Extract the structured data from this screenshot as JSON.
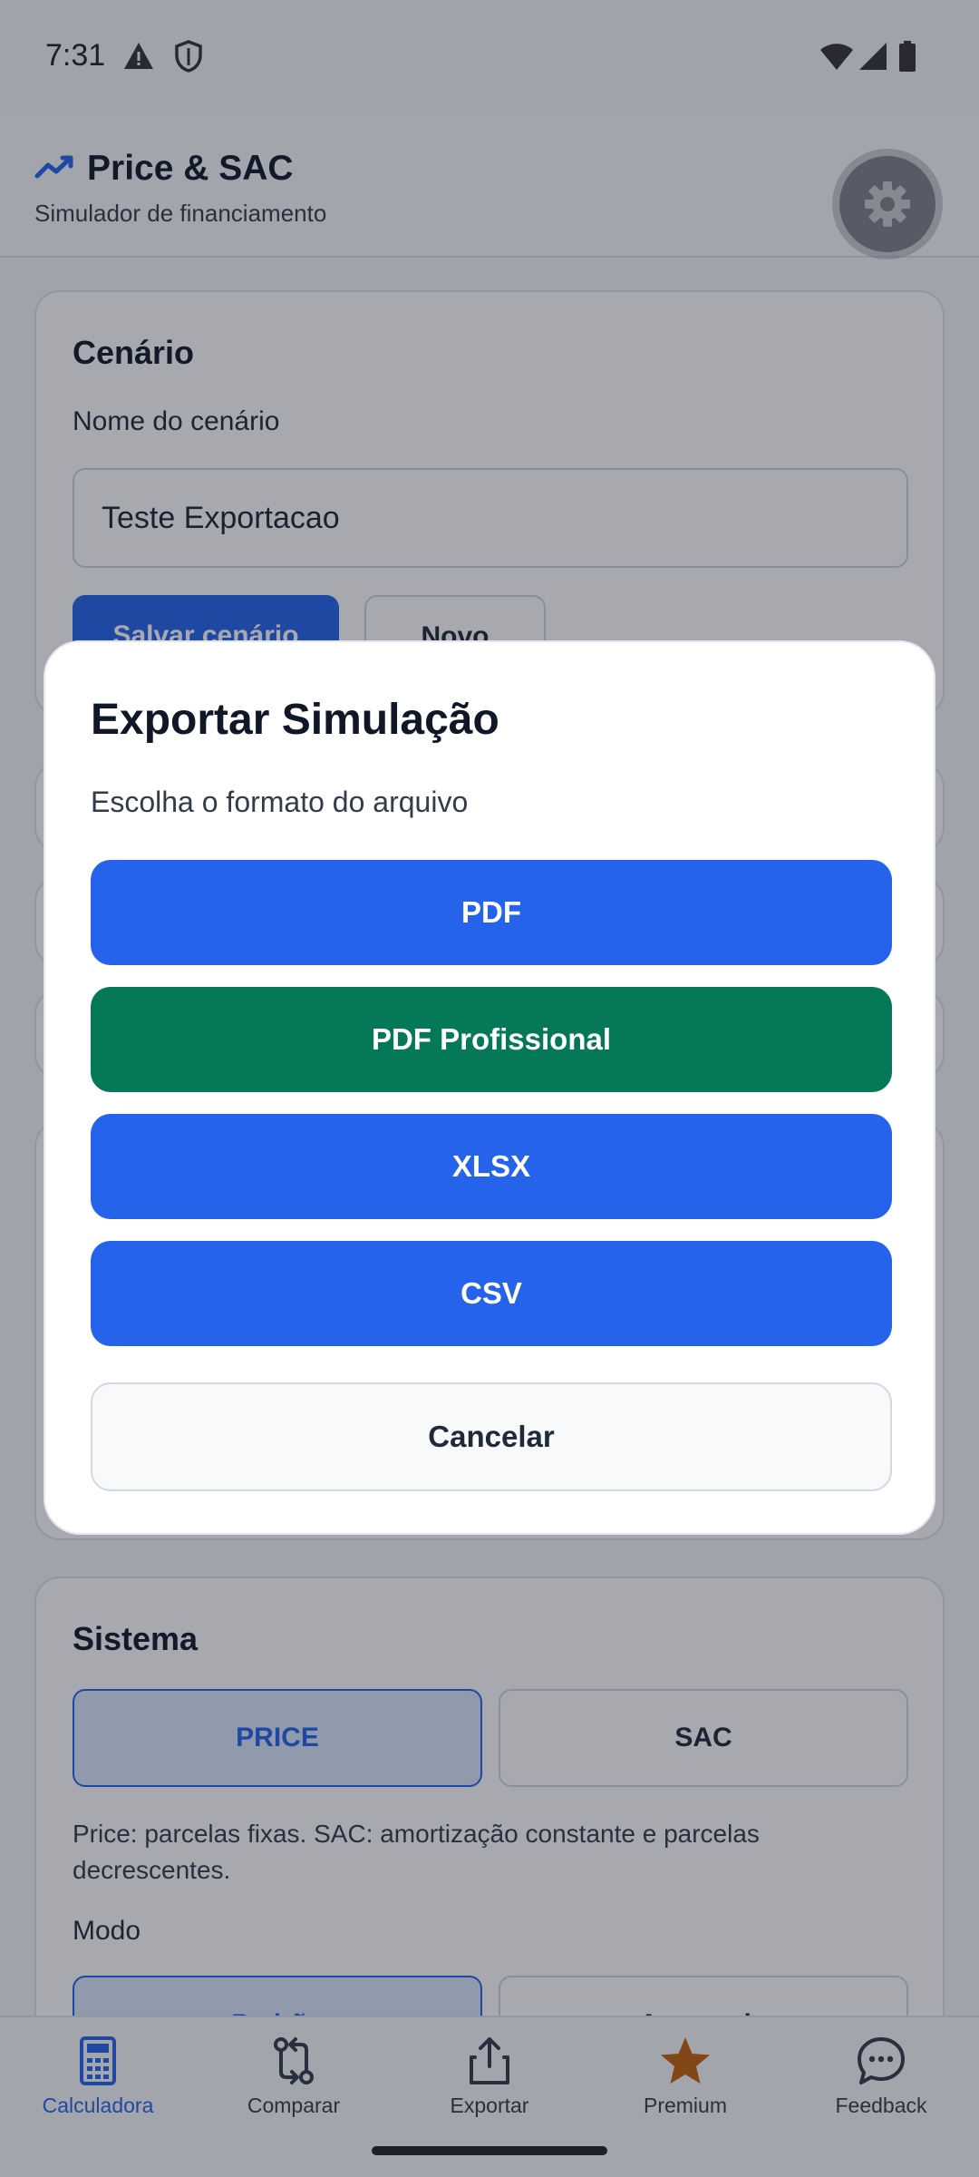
{
  "status_bar": {
    "time": "7:31"
  },
  "header": {
    "title": "Price & SAC",
    "subtitle": "Simulador de financiamento"
  },
  "scenario_card": {
    "title": "Cenário",
    "name_label": "Nome do cenário",
    "name_value": "Teste Exportacao",
    "save_label": "Salvar cenário",
    "new_label": "Novo"
  },
  "system_card": {
    "title": "Sistema",
    "options": [
      "PRICE",
      "SAC"
    ],
    "selected": "PRICE",
    "help_text": "Price: parcelas fixas. SAC: amortização constante e parcelas decrescentes.",
    "mode_label": "Modo",
    "mode_options": [
      "Padrão",
      "Avançado"
    ]
  },
  "dialog": {
    "title": "Exportar Simulação",
    "subtitle": "Escolha o formato do arquivo",
    "buttons": {
      "pdf": "PDF",
      "pdf_pro": "PDF Profissional",
      "xlsx": "XLSX",
      "csv": "CSV",
      "cancel": "Cancelar"
    }
  },
  "bottom_nav": {
    "items": [
      {
        "label": "Calculadora",
        "icon": "calculator-icon",
        "active": true
      },
      {
        "label": "Comparar",
        "icon": "compare-icon",
        "active": false
      },
      {
        "label": "Exportar",
        "icon": "share-icon",
        "active": false
      },
      {
        "label": "Premium",
        "icon": "star-icon",
        "active": false
      },
      {
        "label": "Feedback",
        "icon": "chat-icon",
        "active": false
      }
    ]
  },
  "colors": {
    "primary": "#2563eb",
    "success": "#047857",
    "premium_star": "#c2620b"
  }
}
